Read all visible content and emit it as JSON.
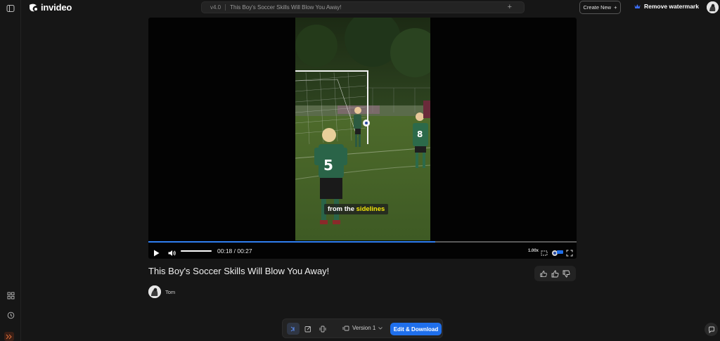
{
  "topbar": {
    "logo_text": "invideo",
    "version_label": "v4.0",
    "project_title": "This Boy's Soccer Skills Will Blow You Away!",
    "create_new_label": "Create New",
    "remove_watermark_label": "Remove watermark"
  },
  "player": {
    "caption_prefix": "from the",
    "caption_highlight": "sidelines",
    "time_display": "00:18 / 00:27",
    "progress_fraction": 0.67,
    "volume_fraction": 1.0,
    "speed_label": "1.00x",
    "jersey_a": "5",
    "jersey_b": "8"
  },
  "video": {
    "title": "This Boy's Soccer Skills Will Blow You Away!",
    "author": "Tom"
  },
  "bottombar": {
    "version_label": "Version 1",
    "edit_download_label": "Edit & Download"
  },
  "colors": {
    "accent": "#1f6feb",
    "progress": "#2f7ef0",
    "caption_highlight": "#f5e80a",
    "background": "#161616"
  },
  "icons": {
    "rail": [
      "sidebar-toggle-icon",
      "apps-grid-icon",
      "history-icon",
      "expand-chevrons-icon"
    ],
    "reactions": [
      "thumbs-up-double-icon",
      "thumbs-up-icon",
      "thumbs-down-icon"
    ],
    "bottombar": [
      "video-icon",
      "edit-icon",
      "mobile-frame-icon"
    ]
  }
}
